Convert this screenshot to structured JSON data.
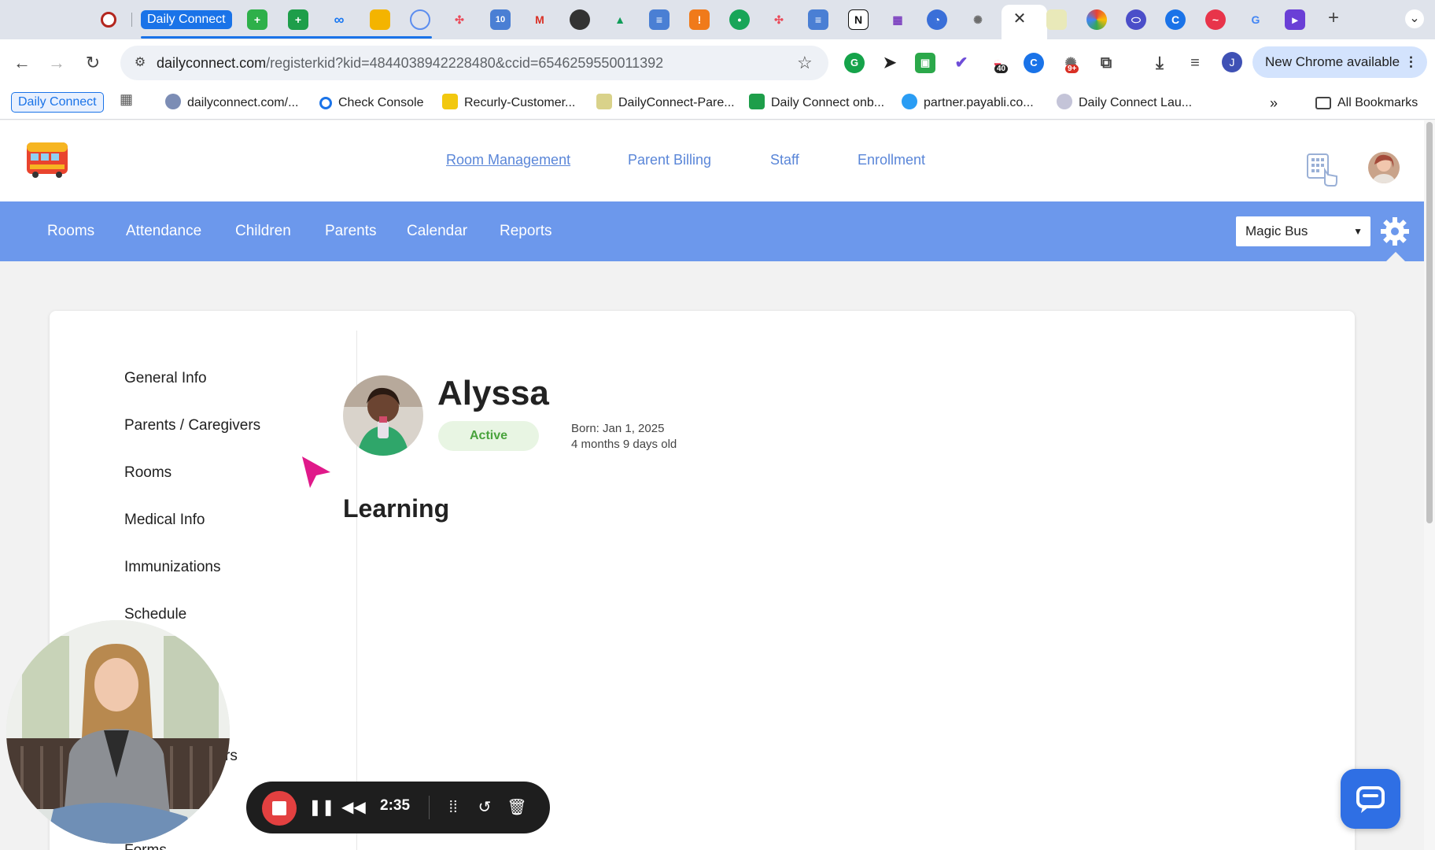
{
  "browser": {
    "active_tab_label": "Daily Connect",
    "url_domain": "dailyconnect.com",
    "url_path": "/registerkid?kid=4844038942228480&ccid=6546259550011392",
    "update_label": "New Chrome available",
    "profile_initial": "J",
    "extension_badges": [
      "40",
      "9+"
    ],
    "bookmarks": [
      "Daily Connect",
      "dailyconnect.com/...",
      "Check Console",
      "Recurly-Customer...",
      "DailyConnect-Pare...",
      "Daily Connect onb...",
      "partner.payabli.co...",
      "Daily Connect Lau..."
    ],
    "all_bookmarks_label": "All Bookmarks"
  },
  "header": {
    "top_nav": [
      "Room Management",
      "Parent Billing",
      "Staff",
      "Enrollment"
    ]
  },
  "subnav": {
    "items": [
      "Rooms",
      "Attendance",
      "Children",
      "Parents",
      "Calendar",
      "Reports"
    ],
    "program": "Magic Bus"
  },
  "sidebar": {
    "items": [
      "General Info",
      "Parents / Caregivers",
      "Rooms",
      "Medical Info",
      "Immunizations",
      "Schedule",
      "rs",
      "Forms"
    ]
  },
  "child": {
    "name": "Alyssa",
    "status": "Active",
    "born": "Born: Jan 1, 2025",
    "age": "4 months 9 days old"
  },
  "main": {
    "section_title": "Learning"
  },
  "recorder": {
    "time": "2:35"
  },
  "colors": {
    "accent": "#6c98ec",
    "link": "#5a86d8",
    "active_green": "#49a33c",
    "record_red": "#e34040",
    "chat_blue": "#2f6fe4"
  }
}
